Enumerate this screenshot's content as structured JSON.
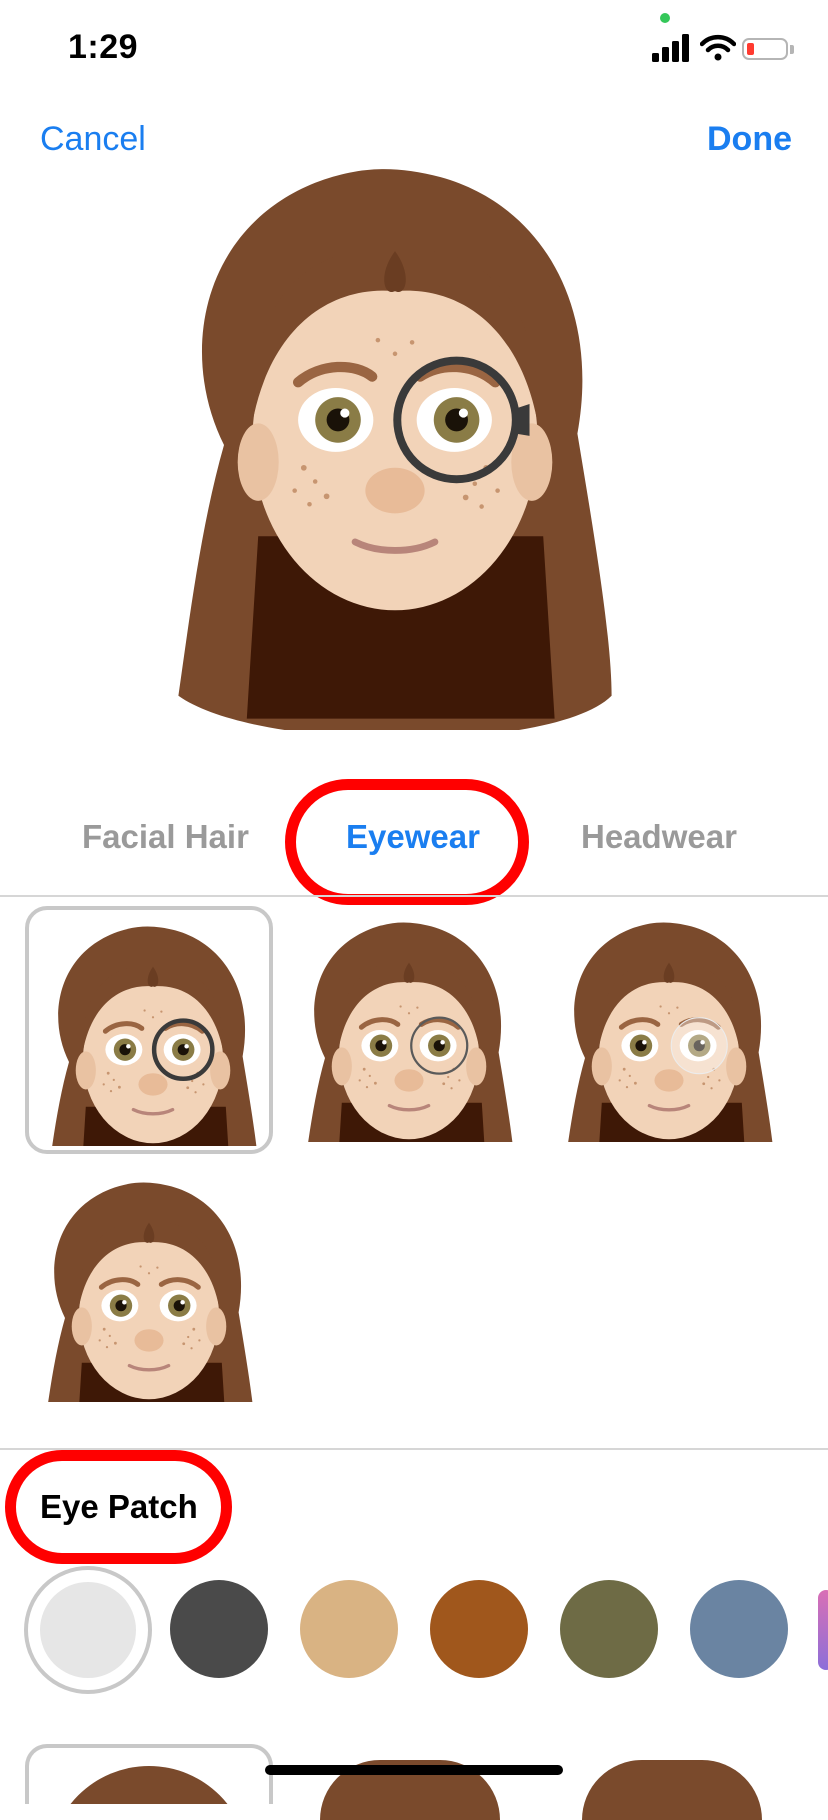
{
  "status_bar": {
    "time": "1:29",
    "battery_color": "#ff3b30",
    "camera_indicator_color": "#34c759"
  },
  "nav": {
    "cancel_label": "Cancel",
    "done_label": "Done"
  },
  "tabs": [
    {
      "label": "Facial Hair",
      "selected": false
    },
    {
      "label": "Eyewear",
      "selected": true
    },
    {
      "label": "Headwear",
      "selected": false
    }
  ],
  "eyewear_options": [
    {
      "name": "dark-round-frame",
      "selected": true
    },
    {
      "name": "thin-round-frame",
      "selected": false
    },
    {
      "name": "rimless",
      "selected": false
    },
    {
      "name": "none",
      "selected": false
    }
  ],
  "eye_patch": {
    "label": "Eye Patch",
    "colors": [
      "#e6e6e6",
      "#4a4a4a",
      "#d9b383",
      "#a0571c",
      "#6e6b45",
      "#6a84a2"
    ],
    "selected_index": 0
  },
  "colors": {
    "accent": "#1a7ef0",
    "highlight": "#ff0000",
    "hair": "#7a4a2c",
    "skin": "#f2d3b8"
  }
}
